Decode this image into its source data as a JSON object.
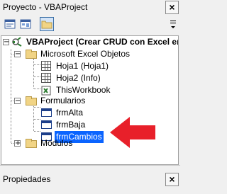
{
  "window": {
    "title": "Proyecto - VBAProject",
    "close_label": "×"
  },
  "toolbar": {
    "buttons": [
      "view-code-icon",
      "view-object-icon",
      "toggle-folders-icon"
    ],
    "active": "toggle-folders-icon"
  },
  "tree": {
    "root": "VBAProject (Crear CRUD con Excel en",
    "groups": {
      "excel_objects": {
        "label": "Microsoft Excel Objetos",
        "items": [
          "Hoja1 (Hoja1)",
          "Hoja2 (Info)",
          "ThisWorkbook"
        ]
      },
      "forms": {
        "label": "Formularios",
        "items": [
          "frmAlta",
          "frmBaja",
          "frmCambios"
        ],
        "selected": "frmCambios"
      },
      "modules": {
        "label": "Módulos"
      }
    },
    "expanded_symbol": "−",
    "collapsed_symbol": "+"
  },
  "properties_panel": {
    "title": "Propiedades",
    "close_label": "×"
  },
  "annotation": {
    "arrow_color": "#e8202a",
    "points_to": "frmCambios"
  },
  "colors": {
    "selection": "#0a64ff",
    "folder": "#f1d485"
  }
}
